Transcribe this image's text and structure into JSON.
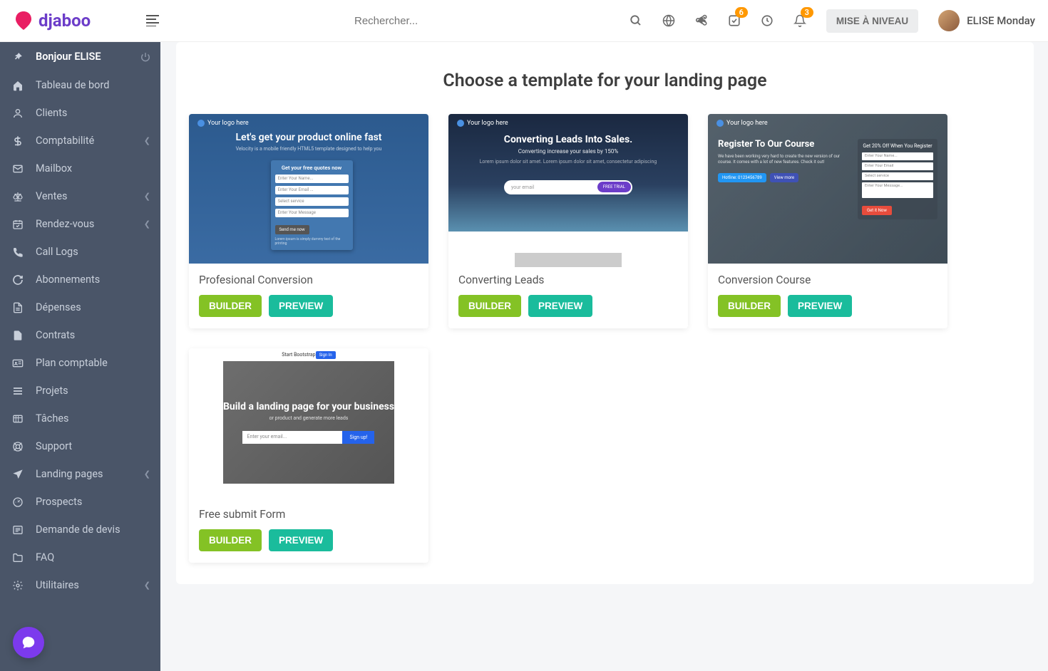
{
  "brand": "djaboo",
  "search": {
    "placeholder": "Rechercher..."
  },
  "header": {
    "badge1": "6",
    "badge2": "3",
    "upgrade_label": "MISE À NIVEAU",
    "user_name": "ELISE Monday"
  },
  "sidebar": {
    "greeting": "Bonjour ELISE",
    "items": [
      {
        "label": "Tableau de bord",
        "icon": "home",
        "expandable": false
      },
      {
        "label": "Clients",
        "icon": "user",
        "expandable": false
      },
      {
        "label": "Comptabilité",
        "icon": "dollar",
        "expandable": true
      },
      {
        "label": "Mailbox",
        "icon": "mail",
        "expandable": false
      },
      {
        "label": "Ventes",
        "icon": "scale",
        "expandable": true
      },
      {
        "label": "Rendez-vous",
        "icon": "calendar-check",
        "expandable": true
      },
      {
        "label": "Call Logs",
        "icon": "phone",
        "expandable": false
      },
      {
        "label": "Abonnements",
        "icon": "refresh",
        "expandable": false
      },
      {
        "label": "Dépenses",
        "icon": "file-lines",
        "expandable": false
      },
      {
        "label": "Contrats",
        "icon": "file",
        "expandable": false
      },
      {
        "label": "Plan comptable",
        "icon": "id-card",
        "expandable": false
      },
      {
        "label": "Projets",
        "icon": "bars",
        "expandable": false
      },
      {
        "label": "Tâches",
        "icon": "tasks",
        "expandable": false
      },
      {
        "label": "Support",
        "icon": "life-ring",
        "expandable": false
      },
      {
        "label": "Landing pages",
        "icon": "paper-plane",
        "expandable": true
      },
      {
        "label": "Prospects",
        "icon": "dashboard",
        "expandable": false
      },
      {
        "label": "Demande de devis",
        "icon": "list",
        "expandable": false
      },
      {
        "label": "FAQ",
        "icon": "folder",
        "expandable": false
      },
      {
        "label": "Utilitaires",
        "icon": "cogs",
        "expandable": true
      }
    ]
  },
  "page": {
    "title": "Choose a template for your landing page",
    "builder_label": "BUILDER",
    "preview_label": "PREVIEW",
    "templates": [
      {
        "name": "Profesional Conversion"
      },
      {
        "name": "Converting Leads"
      },
      {
        "name": "Conversion Course"
      },
      {
        "name": "Free submit Form"
      }
    ],
    "thumb_preview": {
      "logo_text": "Your logo here",
      "t1": {
        "title": "Let's get your product online fast",
        "sub": "Velocity is a mobile friendly HTML5 template designed to help you",
        "form_title": "Get your free quotes now",
        "f1": "Enter Your Name...",
        "f2": "Enter Your Email ...",
        "f3": "Select service",
        "f4": "Enter Your Message",
        "btn": "Send me now",
        "note": "Lorem ipsum is simply dummy text of the printing"
      },
      "t2": {
        "title": "Converting Leads Into Sales.",
        "sub1": "Converting increase your sales by 150%",
        "sub2": "Lorem ipsum dolor sit amet. Lorem ipsum dolor sit amet, consectetur adipiscing",
        "input": "your email",
        "btn": "FREE TRIAL"
      },
      "t3": {
        "title": "Register To Our Course",
        "text": "We have been working very hard to create the new version of our course. It comes with a lot of new features. Check it out!",
        "b1": "Hotline: 0123456789",
        "b2": "View more",
        "right_title": "Get 20% Off When You Register",
        "f1": "Enter Your Name...",
        "f2": "Enter Your Email",
        "f3": "Select service",
        "f4": "Enter Your Message...",
        "btn": "Get it Now"
      },
      "t4": {
        "brand": "Start Bootstrap",
        "signin": "Sign In",
        "title": "Build a landing page for your business",
        "sub": "or product and generate more leads",
        "input": "Enter your email...",
        "btn": "Sign up!"
      }
    }
  }
}
